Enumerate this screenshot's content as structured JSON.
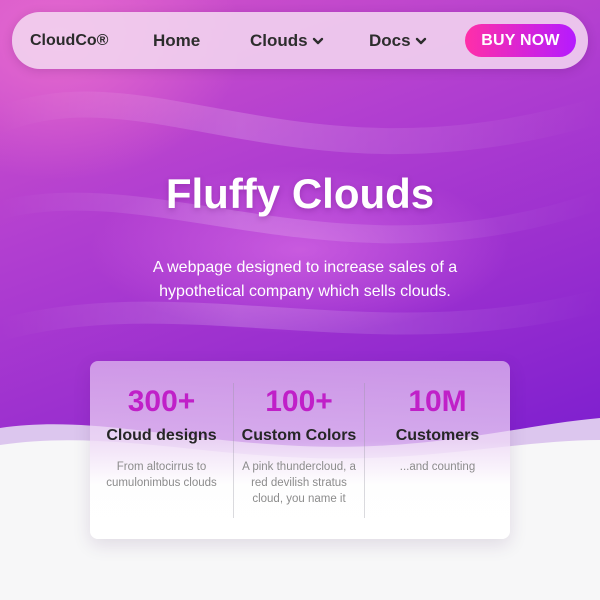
{
  "nav": {
    "brand": "CloudCo®",
    "links": [
      {
        "label": "Home"
      },
      {
        "label": "Clouds"
      },
      {
        "label": "Docs"
      }
    ],
    "cta": "BUY NOW"
  },
  "hero": {
    "title": "Fluffy Clouds",
    "subtitle": "A webpage designed to increase sales of a hypothetical company which sells clouds."
  },
  "stats": [
    {
      "value": "300+",
      "label": "Cloud designs",
      "desc": "From altocirrus to cumulonimbus clouds"
    },
    {
      "value": "100+",
      "label": "Custom Colors",
      "desc": "A pink thundercloud, a red devilish stratus cloud, you name it"
    },
    {
      "value": "10M",
      "label": "Customers",
      "desc": "...and counting"
    }
  ],
  "colors": {
    "accent": "#c020c8",
    "cta_start": "#ff2fa8",
    "cta_end": "#b51bff"
  }
}
